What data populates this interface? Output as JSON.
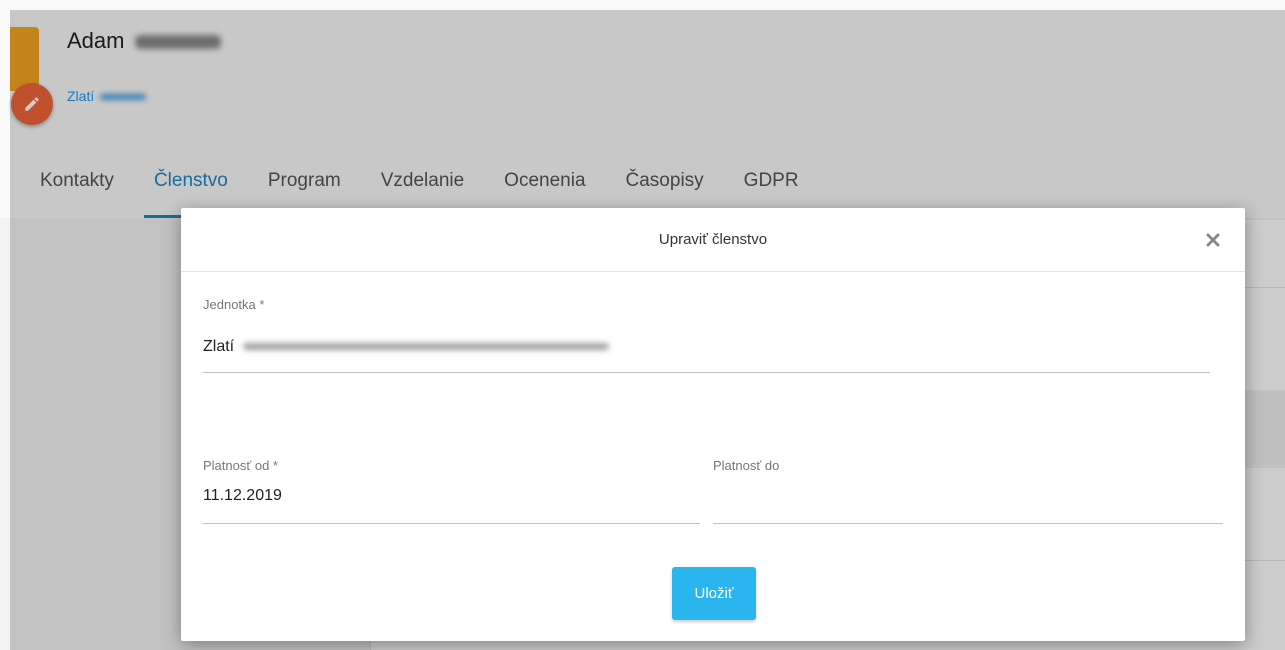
{
  "profile": {
    "name": "Adam",
    "unit": "Zlatí"
  },
  "tabs": [
    {
      "label": "Kontakty"
    },
    {
      "label": "Členstvo"
    },
    {
      "label": "Program"
    },
    {
      "label": "Vzdelanie"
    },
    {
      "label": "Ocenenia"
    },
    {
      "label": "Časopisy"
    },
    {
      "label": "GDPR"
    }
  ],
  "active_tab": "Členstvo",
  "modal": {
    "title": "Upraviť členstvo",
    "close_icon": "close-icon",
    "unit_field": {
      "label": "Jednotka *",
      "value": "Zlatí"
    },
    "valid_from": {
      "label": "Platnosť od *",
      "value": "11.12.2019"
    },
    "valid_to": {
      "label": "Platnosť do",
      "value": ""
    },
    "save_label": "Uložiť"
  },
  "colors": {
    "accent": "#1e88c8",
    "save_button": "#2ab5ef",
    "edit_fab": "#f0653a",
    "avatar": "#f5a623"
  }
}
